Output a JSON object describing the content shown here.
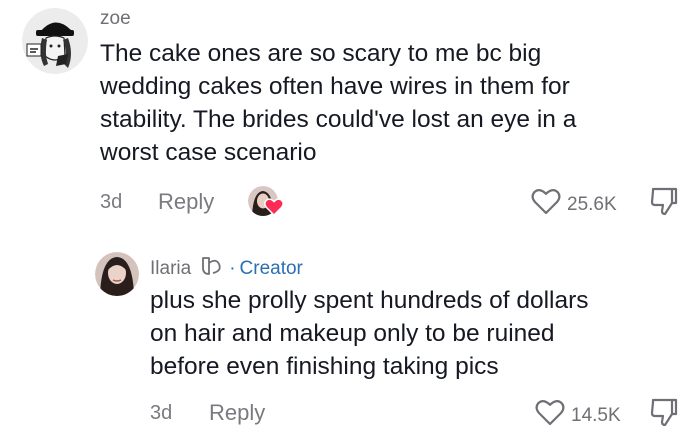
{
  "comments": [
    {
      "username": "zoe",
      "text_lines": [
        "The cake ones are so scary to me bc big",
        "wedding cakes often have wires in them for",
        "stability. The brides could've lost an eye in a",
        "worst case scenario"
      ],
      "time": "3d",
      "reply_label": "Reply",
      "like_count": "25.6K"
    },
    {
      "username": "Ilaria",
      "badge": "Creator",
      "badge_separator": "·",
      "text_lines": [
        "plus she prolly spent hundreds of dollars",
        "on hair and makeup only to be ruined",
        "before even finishing taking pics"
      ],
      "time": "3d",
      "reply_label": "Reply",
      "like_count": "14.5K"
    }
  ],
  "colors": {
    "creator": "#2b6fb2",
    "secondary_text": "#7a7a80",
    "heart_badge": "#fe2c55"
  },
  "icons": {
    "like": "heart-outline-icon",
    "dislike": "thumbs-down-icon",
    "creator_liked": "heart-badge-icon",
    "creator_badge": "creator-badge-icon"
  }
}
